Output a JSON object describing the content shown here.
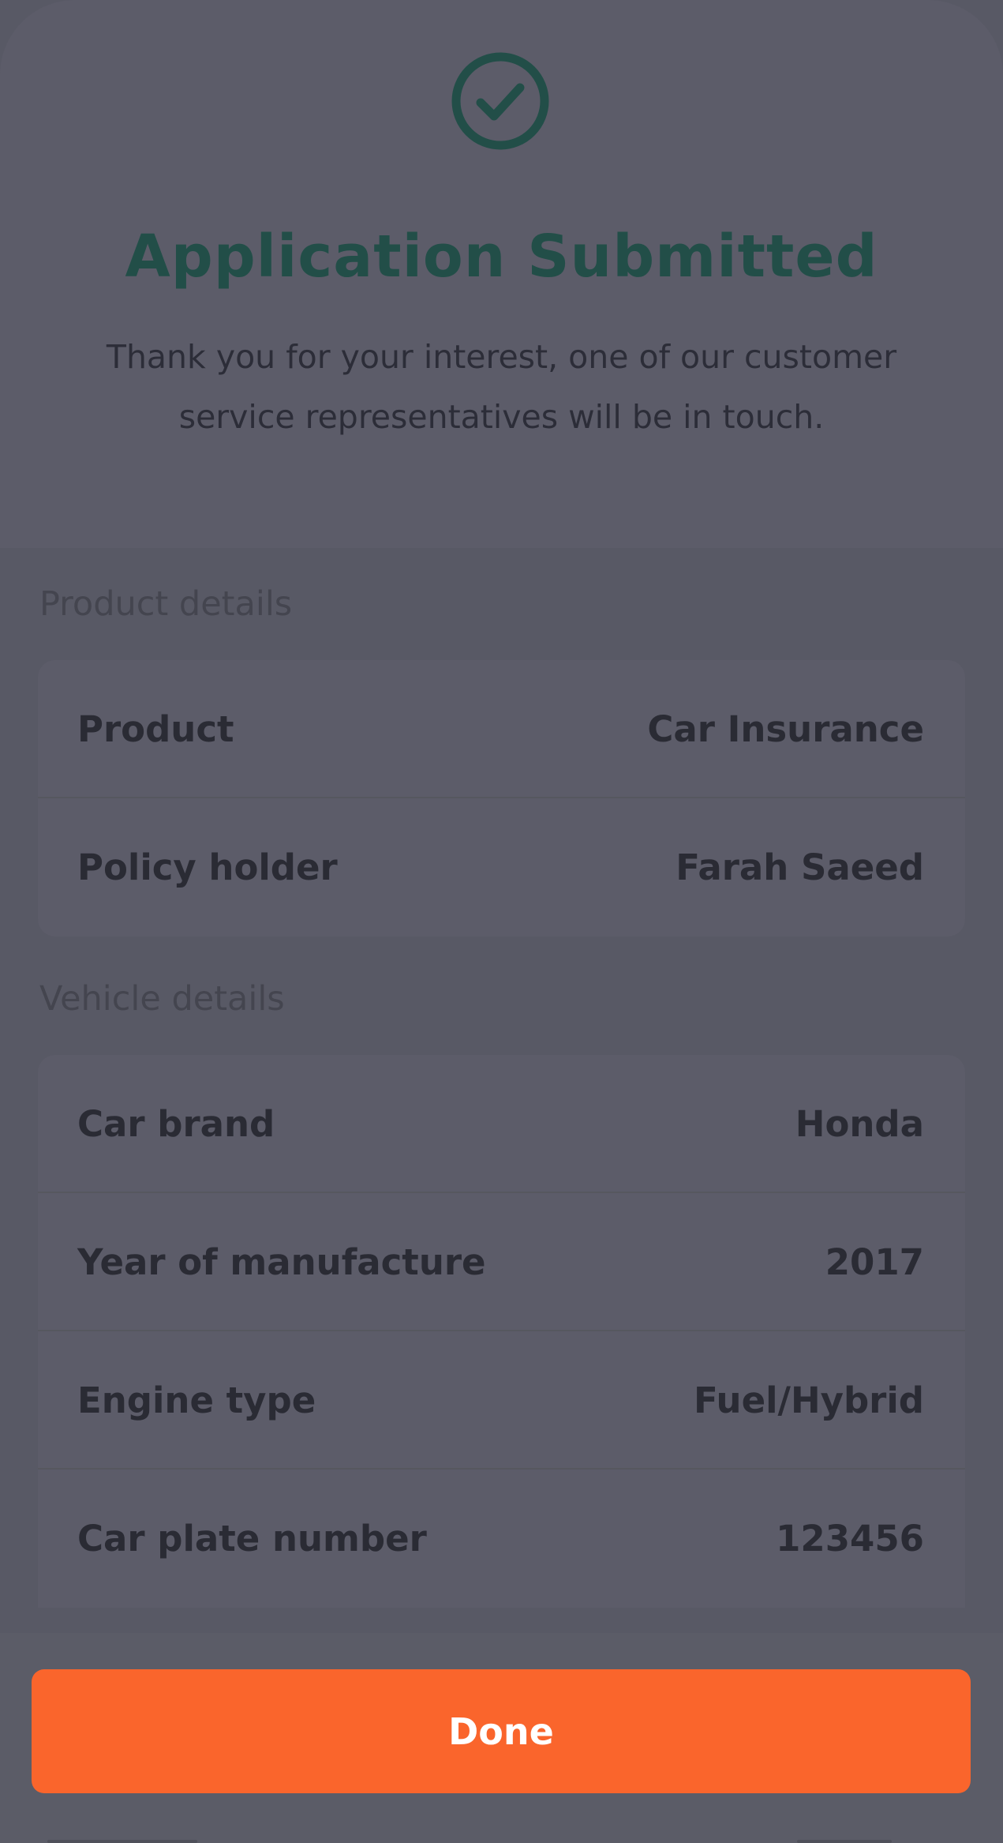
{
  "confirmation": {
    "icon": "check-circle-icon",
    "title": "Application Submitted",
    "message": "Thank you for your interest, one of our customer service representatives will be in touch."
  },
  "product_details": {
    "heading": "Product details",
    "rows": [
      {
        "label": "Product",
        "value": "Car Insurance"
      },
      {
        "label": "Policy holder",
        "value": "Farah Saeed"
      }
    ]
  },
  "vehicle_details": {
    "heading": "Vehicle details",
    "rows": [
      {
        "label": "Car brand",
        "value": "Honda"
      },
      {
        "label": "Year of manufacture",
        "value": "2017"
      },
      {
        "label": "Engine type",
        "value": "Fuel/Hybrid"
      },
      {
        "label": "Car plate number",
        "value": "123456"
      }
    ]
  },
  "actions": {
    "done_label": "Done"
  },
  "colors": {
    "accent": "#fa652c",
    "success": "#224e48",
    "overlay_background": "#5c5c69"
  }
}
